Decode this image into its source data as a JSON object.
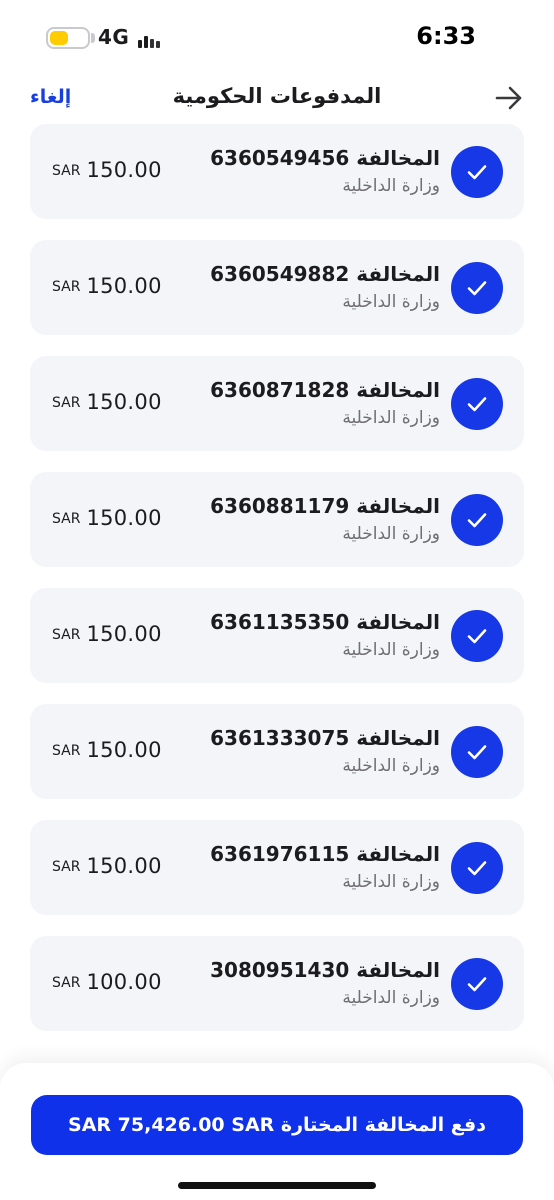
{
  "status_bar": {
    "network": "4G",
    "time": "6:33",
    "battery_level": 0.5
  },
  "header": {
    "title": "المدفوعات الحكومية",
    "cancel_label": "إلغاء",
    "back_icon": "arrow-right-icon"
  },
  "violations": [
    {
      "title": "المخالفة 6360549456",
      "ministry": "وزارة الداخلية",
      "currency": "SAR",
      "amount": "150.00",
      "selected": true
    },
    {
      "title": "المخالفة 6360549882",
      "ministry": "وزارة الداخلية",
      "currency": "SAR",
      "amount": "150.00",
      "selected": true
    },
    {
      "title": "المخالفة 6360871828",
      "ministry": "وزارة الداخلية",
      "currency": "SAR",
      "amount": "150.00",
      "selected": true
    },
    {
      "title": "المخالفة 6360881179",
      "ministry": "وزارة الداخلية",
      "currency": "SAR",
      "amount": "150.00",
      "selected": true
    },
    {
      "title": "المخالفة 6361135350",
      "ministry": "وزارة الداخلية",
      "currency": "SAR",
      "amount": "150.00",
      "selected": true
    },
    {
      "title": "المخالفة 6361333075",
      "ministry": "وزارة الداخلية",
      "currency": "SAR",
      "amount": "150.00",
      "selected": true
    },
    {
      "title": "المخالفة 6361976115",
      "ministry": "وزارة الداخلية",
      "currency": "SAR",
      "amount": "150.00",
      "selected": true
    },
    {
      "title": "المخالفة 3080951430",
      "ministry": "وزارة الداخلية",
      "currency": "SAR",
      "amount": "100.00",
      "selected": true
    }
  ],
  "footer": {
    "pay_label": "دفع المخالفة المختارة SAR 75,426.00 SAR"
  },
  "colors": {
    "accent": "#1638e6",
    "card_bg": "#f4f5f9",
    "battery": "#ffcc00"
  }
}
